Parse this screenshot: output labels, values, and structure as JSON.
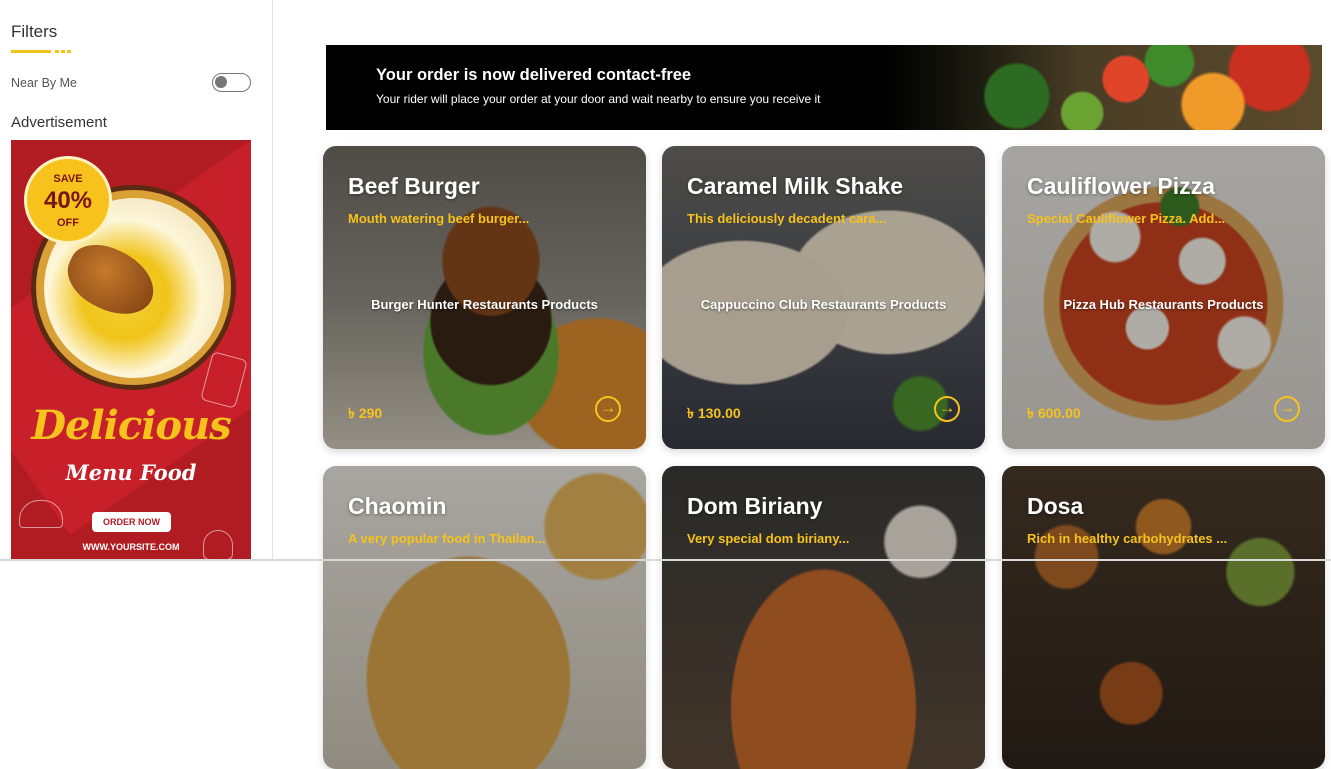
{
  "sidebar": {
    "filters_title": "Filters",
    "near_by_me_label": "Near By Me",
    "near_by_me_on": false,
    "advertisement_label": "Advertisement",
    "ad": {
      "save_top": "SAVE",
      "save_percent": "40%",
      "save_bottom": "OFF",
      "headline": "Delicious",
      "subline": "Menu Food",
      "order_button": "ORDER NOW",
      "site": "WWW.YOURSITE.COM"
    }
  },
  "banner": {
    "title": "Your order is now delivered contact-free",
    "text": "Your rider will place your order at your door and wait nearby to ensure you receive it"
  },
  "products": [
    {
      "name": "Beef Burger",
      "desc": "Mouth watering beef burger...",
      "store": "Burger Hunter Restaurants Products",
      "price": "৳ 290",
      "image": "beef-burger"
    },
    {
      "name": "Caramel Milk Shake",
      "desc": "This deliciously decadent cara...",
      "store": "Cappuccino Club Restaurants Products",
      "price": "৳ 130.00",
      "image": "caramel-milk-shake"
    },
    {
      "name": "Cauliflower Pizza",
      "desc": "Special Cauliflower Pizza. Add...",
      "store": "Pizza Hub Restaurants Products",
      "price": "৳ 600.00",
      "image": "cauliflower-pizza"
    },
    {
      "name": "Chaomin",
      "desc": "A very popular food in Thailan...",
      "image": "chaomin"
    },
    {
      "name": "Dom Biriany",
      "desc": "Very special dom biriany...",
      "image": "dom-biriany"
    },
    {
      "name": "Dosa",
      "desc": "Rich in healthy carbohydrates ...",
      "image": "dosa"
    }
  ],
  "icons": {
    "go": "arrow-right-circle-icon"
  },
  "colors": {
    "accent": "#f6c21b",
    "ad_red": "#b01c22"
  }
}
